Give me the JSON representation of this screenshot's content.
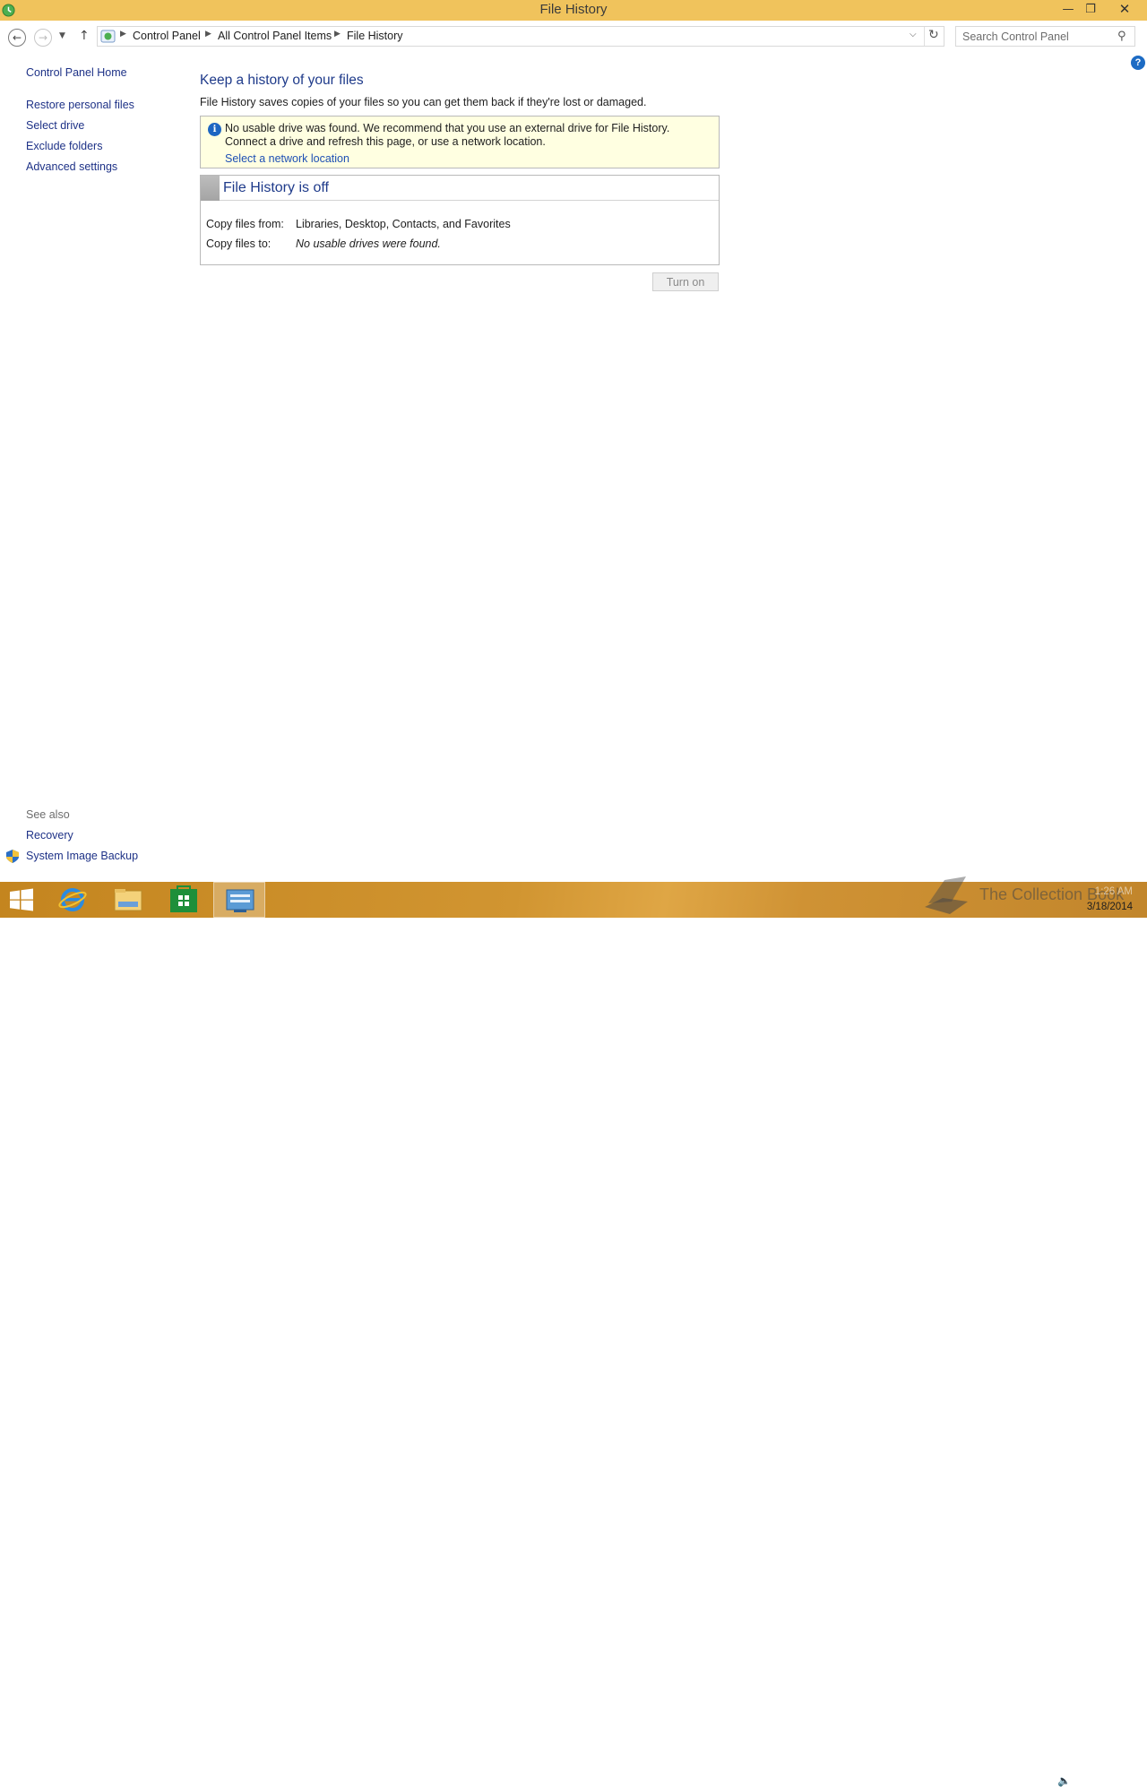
{
  "window": {
    "title": "File History",
    "minimize_glyph": "—",
    "restore_glyph": "❐",
    "close_glyph": "✕"
  },
  "address_bar": {
    "breadcrumbs": [
      "Control Panel",
      "All Control Panel Items",
      "File History"
    ],
    "search_placeholder": "Search Control Panel"
  },
  "left_pane": {
    "home": "Control Panel Home",
    "tasks": [
      "Restore personal files",
      "Select drive",
      "Exclude folders",
      "Advanced settings"
    ],
    "see_also_label": "See also",
    "see_also": [
      "Recovery",
      "System Image Backup"
    ]
  },
  "main": {
    "heading": "Keep a history of your files",
    "description": "File History saves copies of your files so you can get them back if they're lost or damaged.",
    "warning": {
      "message": "No usable drive was found. We recommend that you use an external drive for File History. Connect a drive and refresh this page, or use a network location.",
      "link": "Select a network location"
    },
    "status": {
      "title": "File History is off",
      "rows": [
        {
          "label": "Copy files from:",
          "value": "Libraries, Desktop, Contacts, and Favorites"
        },
        {
          "label": "Copy files to:",
          "value": "No usable drives were found."
        }
      ]
    },
    "turn_on_label": "Turn on",
    "help_glyph": "?"
  },
  "taskbar": {
    "watermark_text": "The Collection Book",
    "time": "1:26 AM",
    "date": "3/18/2014"
  },
  "colors": {
    "titlebar": "#f0c35c",
    "link": "#1e3287",
    "heading": "#1e3a8a",
    "warning_bg": "#ffffe1",
    "taskbar": "#d19531"
  }
}
